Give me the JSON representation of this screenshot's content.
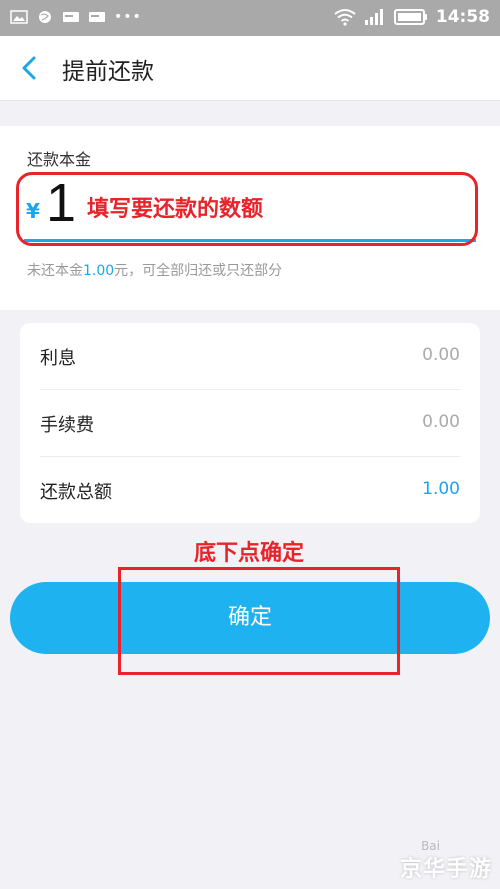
{
  "status_bar": {
    "time": "14:58",
    "icons_left": [
      "image-icon",
      "globe-icon",
      "card-icon",
      "card-icon",
      "more-dots-icon"
    ],
    "icons_right": [
      "wifi-icon",
      "signal-icon",
      "battery-icon"
    ]
  },
  "nav": {
    "title": "提前还款"
  },
  "amount": {
    "label": "还款本金",
    "currency": "¥",
    "value": "1",
    "hint_prefix": "未还本金",
    "hint_amount": "1.00",
    "hint_suffix": "元，可全部归还或只还部分"
  },
  "details": {
    "rows": [
      {
        "label": "利息",
        "value": "0.00"
      },
      {
        "label": "手续费",
        "value": "0.00"
      },
      {
        "label": "还款总额",
        "value": "1.00"
      }
    ]
  },
  "annotations": {
    "amount_note": "填写要还款的数额",
    "confirm_note": "底下点确定"
  },
  "confirm_button": {
    "label": "确定"
  },
  "watermark": {
    "text": "京华手游",
    "sub": "Bai"
  },
  "colors": {
    "accent": "#1aa7e8",
    "button": "#1eb2f0",
    "annotation": "#e8232a",
    "status_bar": "#a9a9a9"
  }
}
